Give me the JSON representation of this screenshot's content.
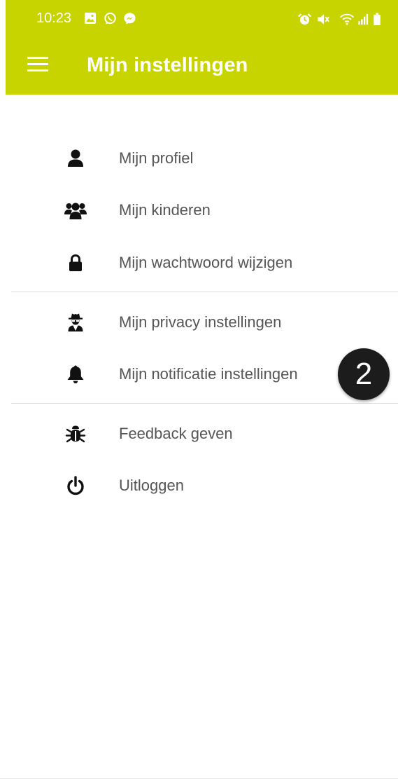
{
  "status_bar": {
    "time": "10:23",
    "left_icons": [
      "gallery-icon",
      "whatsapp-icon",
      "messenger-icon"
    ],
    "right_icons": [
      "alarm-icon",
      "mute-icon",
      "wifi-icon",
      "signal-icon",
      "battery-icon"
    ]
  },
  "app_bar": {
    "title": "Mijn instellingen",
    "background": "#c8d400",
    "menu_icon": "hamburger-menu-icon"
  },
  "menu": {
    "groups": [
      [
        {
          "label": "Mijn profiel",
          "icon": "user-icon"
        },
        {
          "label": "Mijn kinderen",
          "icon": "users-icon"
        },
        {
          "label": "Mijn wachtwoord wijzigen",
          "icon": "lock-icon"
        }
      ],
      [
        {
          "label": "Mijn privacy instellingen",
          "icon": "user-secret-icon"
        },
        {
          "label": "Mijn notificatie instellingen",
          "icon": "bell-icon"
        }
      ],
      [
        {
          "label": "Feedback geven",
          "icon": "bug-icon"
        },
        {
          "label": "Uitloggen",
          "icon": "power-icon"
        }
      ]
    ]
  },
  "annotation_badge": {
    "text": "2"
  }
}
